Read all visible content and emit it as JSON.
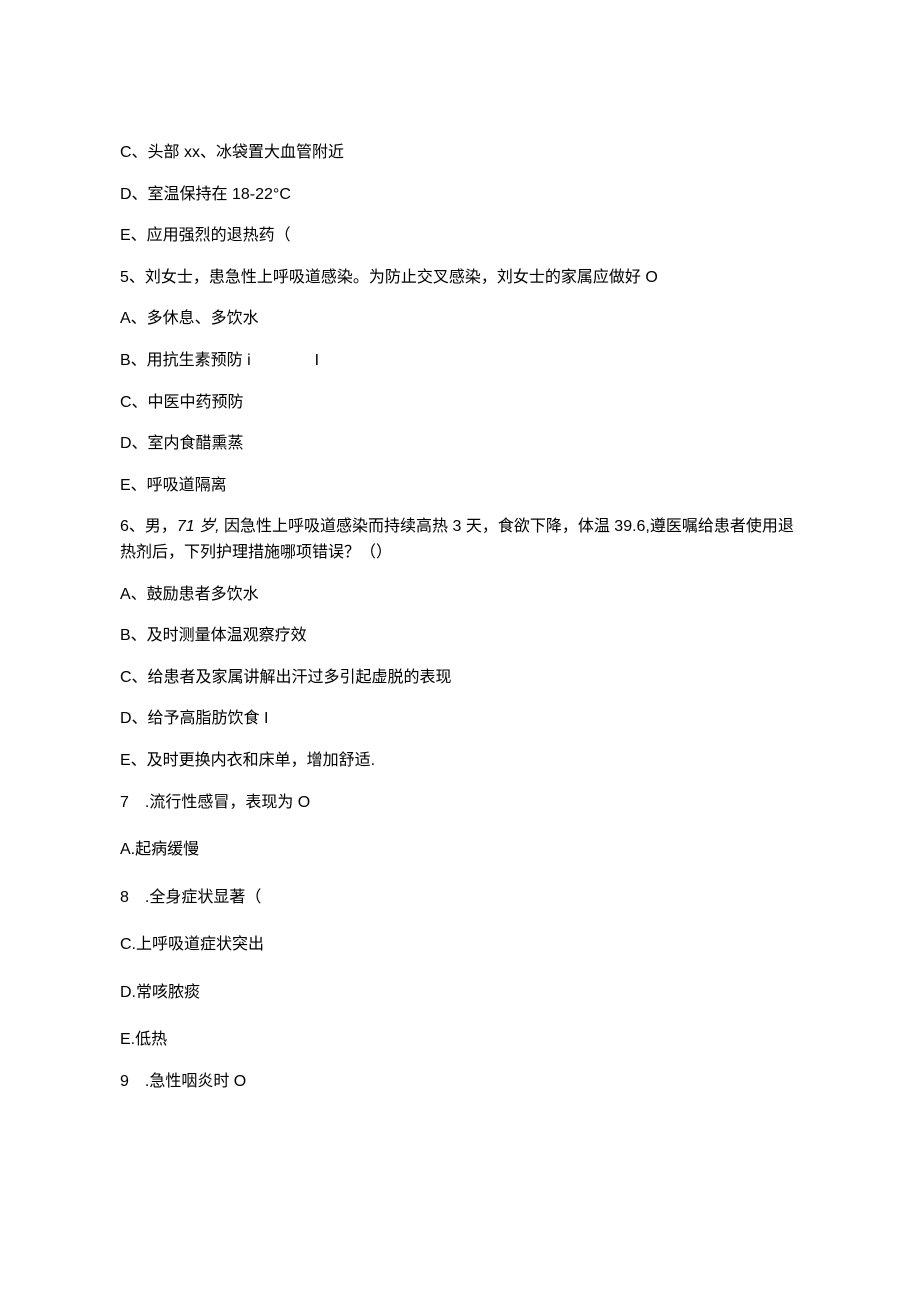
{
  "q4_tail": {
    "optC": "C、头部 xx、冰袋置大血管附近",
    "optD": "D、室温保持在 18-22°C",
    "optE": "E、应用强烈的退热药（"
  },
  "q5": {
    "stem": "5、刘女士，患急性上呼吸道感染。为防止交叉感染，刘女士的家属应做好 O",
    "optA": "A、多休息、多饮水",
    "optB": "B、用抗生素预防 i    I",
    "optC": "C、中医中药预防",
    "optD": "D、室内食醋熏蒸",
    "optE": "E、呼吸道隔离"
  },
  "q6": {
    "stem_part1": "6、男，",
    "stem_italic": "71 岁,",
    "stem_part2": " 因急性上呼吸道感染而持续高热 3 天，食欲下降，体温 39.6,遵医嘱给患者使用退热剂后，下列护理措施哪项错误？（）",
    "optA": "A、鼓励患者多饮水",
    "optB": "B、及时测量体温观察疗效",
    "optC": "C、给患者及家属讲解出汗过多引起虚脱的表现",
    "optD": "D、给予高脂肪饮食 I",
    "optE": "E、及时更换内衣和床单，增加舒适."
  },
  "q7": {
    "stem": "7 .流行性感冒，表现为 O",
    "optA": "A.起病缓慢",
    "opt8": "8 .全身症状显著（",
    "optC": "C.上呼吸道症状突出",
    "optD": "D.常咳脓痰",
    "optE": "E.低热"
  },
  "q9": {
    "stem": "9 .急性咽炎时 O"
  }
}
